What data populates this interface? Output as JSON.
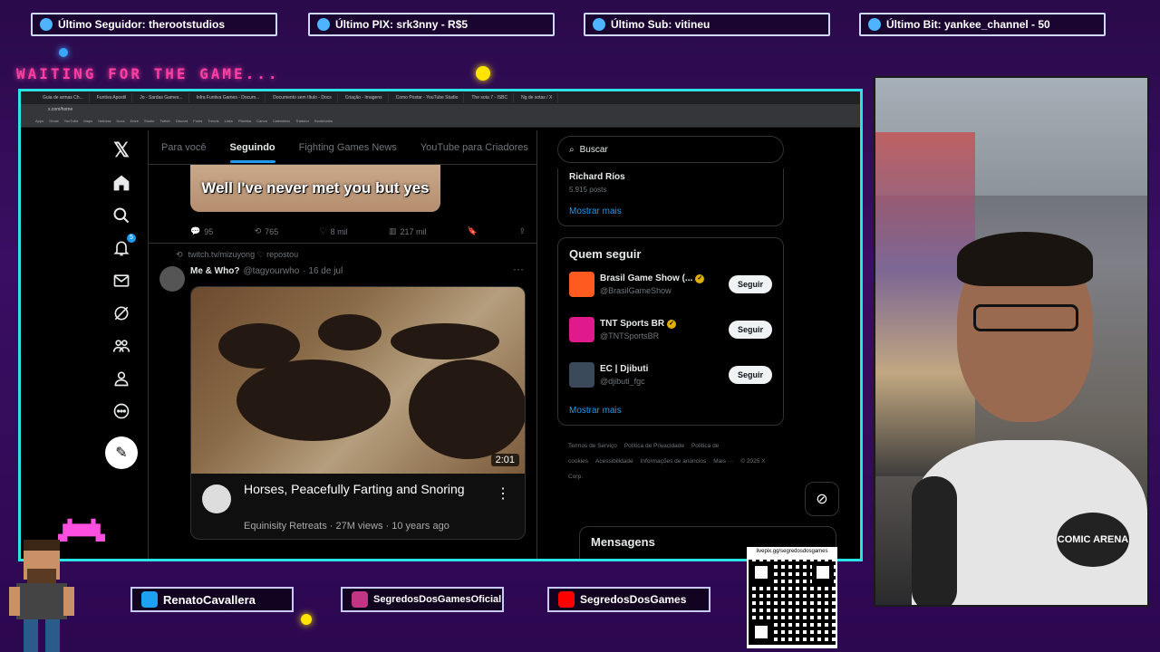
{
  "overlay": {
    "stats": [
      {
        "label": "Último Seguidor: therootstudios",
        "icon": "user-icon"
      },
      {
        "label": "Último PIX: srk3nny - R$5",
        "icon": "dollar-icon"
      },
      {
        "label": "Último Sub: vitineu",
        "icon": "star-icon"
      },
      {
        "label": "Último Bit: yankee_channel - 50",
        "icon": "diamond-icon"
      }
    ],
    "waiting": "WAITING FOR THE GAME...",
    "socials": [
      {
        "label": "RenatoCavallera",
        "icon": "twitter-icon",
        "color": "#1da1f2"
      },
      {
        "label": "SegredosDosGamesOficial",
        "icon": "instagram-icon",
        "color": "#c13584"
      },
      {
        "label": "SegredosDosGames",
        "icon": "youtube-icon",
        "color": "#ff0000"
      }
    ],
    "qr_url": "livepix.gg/segredosdosgames",
    "webcam_badge": "COMIC ARENA"
  },
  "browser": {
    "tabs": [
      "Guia de armas Ch...",
      "Funtiva Apostil",
      "Jo - Sardas Games...",
      "Infra Funtiva Games - Docum...",
      "Documento sem título - Docs",
      "Criação - Imagens",
      "Como Postar - YouTube Studio",
      "The sota 7 - ISBC",
      "Ng de sotas / X"
    ],
    "url": "x.com/home",
    "bookmarks": [
      "Apps",
      "Gmail",
      "YouTube",
      "Maps",
      "Notícias",
      "Docs",
      "Drive",
      "Studio",
      "Twitch",
      "Discord",
      "Fonts",
      "Trends",
      "Links",
      "Planilha",
      "Canva",
      "Calendário",
      "Tradutor",
      "Bookmarks"
    ]
  },
  "x": {
    "nav": {
      "notifications_badge": "5"
    },
    "feed_tabs": [
      "Para você",
      "Seguindo",
      "Fighting Games News",
      "YouTube para Criadores"
    ],
    "active_tab_index": 1,
    "post1": {
      "meme_text": "Well I've never met you but yes",
      "replies": "95",
      "reposts": "765",
      "likes": "8 mil",
      "views": "217 mil"
    },
    "post2": {
      "repost_by": "twitch.tv/mizuyong ♡ repostou",
      "name": "Me & Who?",
      "handle": "@tagyourwho",
      "date": "· 16 de jul",
      "video_duration": "2:01",
      "yt_title": "Horses, Peacefully Farting and Snoring",
      "yt_meta": "Equinisity Retreats · 27M views · 10 years ago"
    },
    "search_placeholder": "Buscar",
    "trend": {
      "name": "Richard Ríos",
      "count": "5.915 posts",
      "show_more": "Mostrar mais"
    },
    "who_to_follow": {
      "title": "Quem seguir",
      "show_more": "Mostrar mais",
      "follow_label": "Seguir",
      "accounts": [
        {
          "name": "Brasil Game Show (...",
          "handle": "@BrasilGameShow",
          "color": "#ff5a1f",
          "verified": true
        },
        {
          "name": "TNT Sports BR",
          "handle": "@TNTSportsBR",
          "color": "#e0198c",
          "verified": true
        },
        {
          "name": "EC | Djibuti",
          "handle": "@djibuti_fgc",
          "color": "#3a4a5a",
          "verified": false
        }
      ]
    },
    "footer": [
      "Termos de Serviço",
      "Política de Privacidade",
      "Política de cookies",
      "Acessibilidade",
      "Informações de anúncios",
      "Mais ···",
      "© 2025 X Corp."
    ],
    "messages": "Mensagens"
  }
}
